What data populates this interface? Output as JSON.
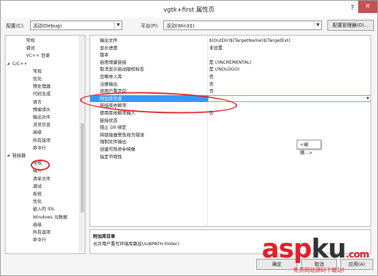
{
  "window": {
    "title": "vgtk+first 属性页",
    "help_glyph": "?",
    "close_glyph": "✕"
  },
  "config": {
    "config_label": "配置(C):",
    "config_value": "活动(Debug)",
    "platform_label": "平台(P):",
    "platform_value": "活动(Win32)",
    "manager_button": "配置管理器(O)..."
  },
  "tree": {
    "items": [
      {
        "label": "常规",
        "level": 1
      },
      {
        "label": "调试",
        "level": 1
      },
      {
        "label": "VC++ 目录",
        "level": 1
      },
      {
        "label": "C/C++",
        "level": 0,
        "expanded": true
      },
      {
        "label": "常规",
        "level": 2
      },
      {
        "label": "优化",
        "level": 2
      },
      {
        "label": "预处理器",
        "level": 2
      },
      {
        "label": "代码生成",
        "level": 2
      },
      {
        "label": "语言",
        "level": 2
      },
      {
        "label": "预编译头",
        "level": 2
      },
      {
        "label": "输出文件",
        "level": 2
      },
      {
        "label": "浏览信息",
        "level": 2
      },
      {
        "label": "高级",
        "level": 2
      },
      {
        "label": "所有选项",
        "level": 2
      },
      {
        "label": "命令行",
        "level": 2
      },
      {
        "label": "链接器",
        "level": 0,
        "expanded": true
      },
      {
        "label": "常规",
        "level": 2,
        "selected": true
      },
      {
        "label": "输入",
        "level": 2
      },
      {
        "label": "清单文件",
        "level": 2
      },
      {
        "label": "调试",
        "level": 2
      },
      {
        "label": "系统",
        "level": 2
      },
      {
        "label": "优化",
        "level": 2
      },
      {
        "label": "嵌入的 IDL",
        "level": 2
      },
      {
        "label": "Windows 元数据",
        "level": 2
      },
      {
        "label": "高级",
        "level": 2
      },
      {
        "label": "所有选项",
        "level": 2
      },
      {
        "label": "命令行",
        "level": 2
      }
    ]
  },
  "grid": {
    "rows": [
      {
        "name": "输出文件",
        "value": "$(OutDir)$(TargetName)$(TargetExt)"
      },
      {
        "name": "显示进度",
        "value": "未设置"
      },
      {
        "name": "版本",
        "value": ""
      },
      {
        "name": "启用增量链接",
        "value": "是 (/INCREMENTAL)"
      },
      {
        "name": "取消显示启动版权标志",
        "value": "是 (/NOLOGO)"
      },
      {
        "name": "忽略导入库",
        "value": "否"
      },
      {
        "name": "注册输出",
        "value": "否"
      },
      {
        "name": "逐用户重定向",
        "value": "否"
      },
      {
        "name": "附加库目录",
        "value": "",
        "selected": true
      },
      {
        "name": "链接库依赖项",
        "value": ""
      },
      {
        "name": "使用库依赖项输入",
        "value": "否"
      },
      {
        "name": "链接状态",
        "value": ""
      },
      {
        "name": "阻止 Dll 绑定",
        "value": ""
      },
      {
        "name": "将链接器警告视为错误",
        "value": ""
      },
      {
        "name": "强制文件输出",
        "value": ""
      },
      {
        "name": "创建可热修补映像",
        "value": ""
      },
      {
        "name": "指定节特性",
        "value": ""
      }
    ],
    "popup_item": "<编辑...>"
  },
  "description": {
    "heading": "附加库目录",
    "text": "允许用户重写环境库路径(/LIBPATH:folder)"
  },
  "buttons": {
    "ok": "确定",
    "cancel": "取消",
    "apply": "应用(A)"
  },
  "watermark": {
    "logo_a": "asp",
    "logo_b": "ku",
    "logo_c": ".com",
    "subtitle": "免费网站源码下载站!"
  },
  "colors": {
    "selection": "#3399ff",
    "annotation": "#e0202a",
    "close": "#c75050"
  }
}
